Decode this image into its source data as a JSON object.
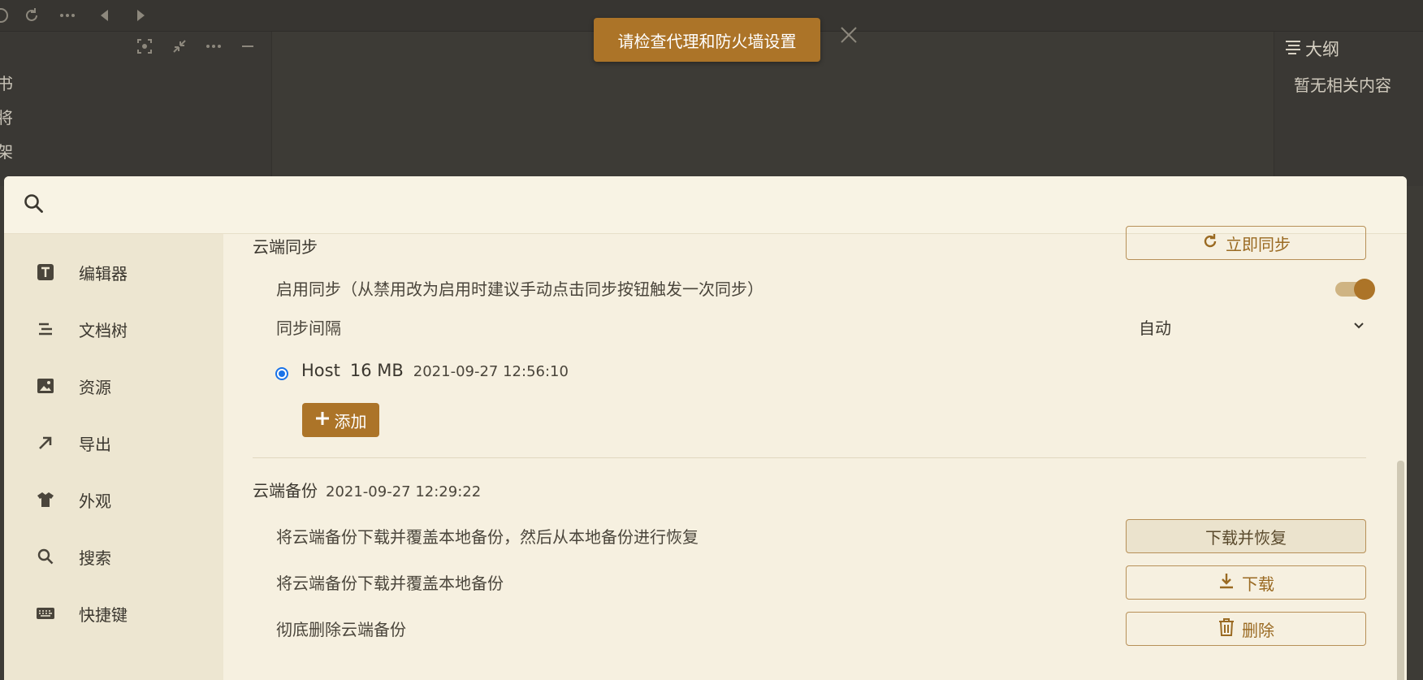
{
  "toast": {
    "message": "请检查代理和防火墙设置"
  },
  "outline": {
    "title": "大纲",
    "empty_text": "暂无相关内容"
  },
  "background_left_fragments": [
    "书",
    "将",
    "架"
  ],
  "search": {
    "value": "",
    "placeholder": ""
  },
  "sidebar": {
    "items": [
      {
        "label": "编辑器",
        "icon": "text-t-icon"
      },
      {
        "label": "文档树",
        "icon": "tree-list-icon"
      },
      {
        "label": "资源",
        "icon": "image-icon"
      },
      {
        "label": "导出",
        "icon": "export-arrow-icon"
      },
      {
        "label": "外观",
        "icon": "shirt-icon"
      },
      {
        "label": "搜索",
        "icon": "search-icon"
      },
      {
        "label": "快捷键",
        "icon": "keyboard-icon"
      }
    ]
  },
  "sync": {
    "title": "云端同步",
    "sync_now_label": "立即同步",
    "enable_label": "启用同步（从禁用改为启用时建议手动点击同步按钮触发一次同步）",
    "enabled": true,
    "interval_label": "同步间隔",
    "interval_value": "自动",
    "host": {
      "name": "Host",
      "size": "16 MB",
      "time": "2021-09-27 12:56:10",
      "selected": true
    },
    "add_label": "添加"
  },
  "backup": {
    "title": "云端备份",
    "time": "2021-09-27 12:29:22",
    "rows": [
      {
        "text": "将云端备份下载并覆盖本地备份，然后从本地备份进行恢复",
        "button": "下载并恢复"
      },
      {
        "text": "将云端备份下载并覆盖本地备份",
        "button": "下载"
      },
      {
        "text": "彻底删除云端备份",
        "button": "删除"
      }
    ]
  },
  "colors": {
    "accent": "#ac7428",
    "dialog_bg": "#f6f0e0",
    "sidebar_bg": "#ede6d1",
    "app_bg": "#3d3b36",
    "radio": "#1a73e8"
  }
}
